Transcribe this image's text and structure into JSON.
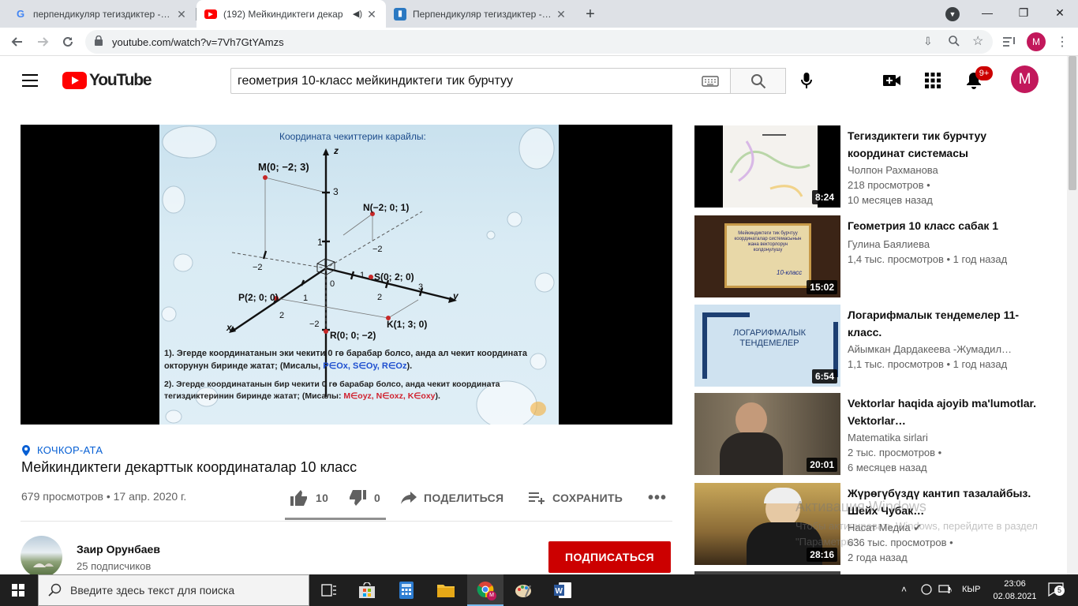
{
  "browser": {
    "tabs": [
      {
        "title": "перпендикуляр тегиздиктер - Goo",
        "favicon": "google-icon",
        "active": false
      },
      {
        "title": "(192) Мейкиндиктеги декар",
        "favicon": "youtube-icon",
        "active": true
      },
      {
        "title": "Перпендикуляр тегиздиктер - Пр",
        "favicon": "book-icon",
        "active": false
      }
    ],
    "url": "youtube.com/watch?v=7Vh7GtYAmzs",
    "profile_letter": "M"
  },
  "youtube": {
    "logo_text": "YouTube",
    "search_query": "геометрия 10-класс мейкиндиктеги тик бурчтуу",
    "notifications_badge": "9+",
    "avatar_letter": "M",
    "accent": "#ff0000"
  },
  "slide": {
    "heading": "Координата чекиттерин карайлы:",
    "points": {
      "m": "M(0; −2; 3)",
      "n": "N(−2; 0; 1)",
      "s": "S(0; 2; 0)",
      "p": "P(2; 0; 0)",
      "k": "K(1; 3; 0)",
      "r": "R(0; 0; −2)"
    },
    "axes": {
      "x": "x",
      "y": "y",
      "z": "z"
    },
    "ticks": {
      "z3": "3",
      "z1": "1",
      "neg2a": "−2",
      "neg2b": "−2",
      "neg2c": "−2",
      "o": "0",
      "y1": "1",
      "y2": "2",
      "y3": "3",
      "x1": "1",
      "x2": "2"
    },
    "rule1_a": "1). Эгерде координатанын эки чекити 0 гө барабар болсо, анда ал чекит координата",
    "rule1_b": "окторунун биринде жатат; (Мисалы, ",
    "rule1_ex": "P∈Ox, S∈Oy, R∈Oz",
    "rule1_end": ").",
    "rule2_a": "2). Эгерде координатанын бир чекити 0 гө барабар болсо, анда чекит координата",
    "rule2_b": "тегиздиктеринин биринде жатат; (Мисалы: ",
    "rule2_ex": "M∈oyz, N∈oxz, K∈oxy",
    "rule2_end": ")."
  },
  "video": {
    "location": "КОЧКОР-АТА",
    "title": "Мейкиндиктеги декарттык координаталар 10 класс",
    "meta": "679 просмотров • 17 апр. 2020 г.",
    "likes": "10",
    "dislikes": "0",
    "share_label": "ПОДЕЛИТЬСЯ",
    "save_label": "СОХРАНИТЬ"
  },
  "channel": {
    "name": "Заир Орунбаев",
    "subscribers": "25 подписчиков",
    "subscribe_label": "ПОДПИСАТЬСЯ"
  },
  "related": [
    {
      "title": "Тегиздиктеги тик бурчтуу координат системасы",
      "channel": "Чолпон Рахманова",
      "line2": "218 просмотров •",
      "line3": "10 месяцев назад",
      "duration": "8:24"
    },
    {
      "title": "Геометрия 10 класс сабак 1",
      "channel": "Гулина Баялиева",
      "line2": "1,4 тыс. просмотров • 1 год назад",
      "line3": "",
      "duration": "15:02",
      "thumb_text": "Мейкиндиктеги тик бурчтуу координаталар системасынын жана векторлорун колдонулушу",
      "thumb_sub": "10-класс"
    },
    {
      "title": "Логарифмалык тендемелер 11-класс.",
      "channel": "Айымкан Дардакеева -Жумадил…",
      "line2": "1,1 тыс. просмотров • 1 год назад",
      "line3": "",
      "duration": "6:54",
      "thumb_text": "ЛОГАРИФМАЛЫК ТЕНДЕМЕЛЕР"
    },
    {
      "title": "Vektorlar haqida ajoyib ma'lumotlar. Vektorlar…",
      "channel": "Matematika sirlari",
      "line2": "2 тыс. просмотров •",
      "line3": "6 месяцев назад",
      "duration": "20:01"
    },
    {
      "title": "Жүрөгүбүздү кантип тазалайбыз. Шейх Чубак…",
      "channel": "Насат Медиа",
      "line2": "636 тыс. просмотров •",
      "line3": "2 года назад",
      "duration": "28:16"
    }
  ],
  "watermark": {
    "line1": "Активация Windows",
    "line2": "Чтобы активировать Windows, перейдите в раздел \"Параметры\"."
  },
  "taskbar": {
    "search_placeholder": "Введите здесь текст для поиска",
    "lang": "КЫР",
    "time": "23:06",
    "date": "02.08.2021",
    "notif_count": "5"
  }
}
